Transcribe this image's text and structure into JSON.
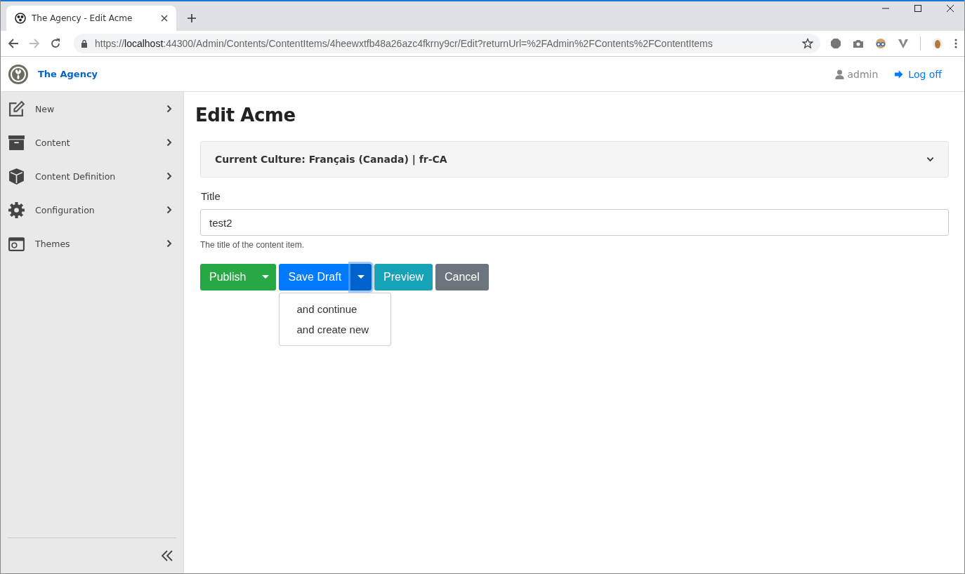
{
  "browser": {
    "tab": {
      "title": "The Agency - Edit Acme"
    },
    "url": {
      "scheme": "https://",
      "host": "localhost",
      "rest": ":44300/Admin/Contents/ContentItems/4heewxtfb48a26azc4fkrny9cr/Edit?returnUrl=%2FAdmin%2FContents%2FContentItems"
    }
  },
  "header": {
    "brand": "The Agency",
    "user": "admin",
    "logoff": "Log off"
  },
  "sidebar": {
    "items": [
      {
        "label": "New",
        "kind": "edit"
      },
      {
        "label": "Content",
        "kind": "archive"
      },
      {
        "label": "Content Definition",
        "kind": "cube"
      },
      {
        "label": "Configuration",
        "kind": "gear"
      },
      {
        "label": "Themes",
        "kind": "window"
      }
    ]
  },
  "page": {
    "title": "Edit Acme",
    "culture": {
      "text": "Current Culture: Français (Canada) | fr-CA",
      "expanded": false
    },
    "field": {
      "label": "Title",
      "value": "test2",
      "hint": "The title of the content item."
    },
    "buttons": [
      {
        "label": "Publish",
        "kind": "success",
        "toggle": {
          "open": false
        }
      },
      {
        "label": "Save Draft",
        "kind": "primary",
        "toggle": {
          "open": true,
          "menu": [
            "and continue",
            "and create new"
          ]
        }
      },
      {
        "label": "Preview",
        "kind": "info"
      },
      {
        "label": "Cancel",
        "kind": "secondary"
      }
    ]
  }
}
